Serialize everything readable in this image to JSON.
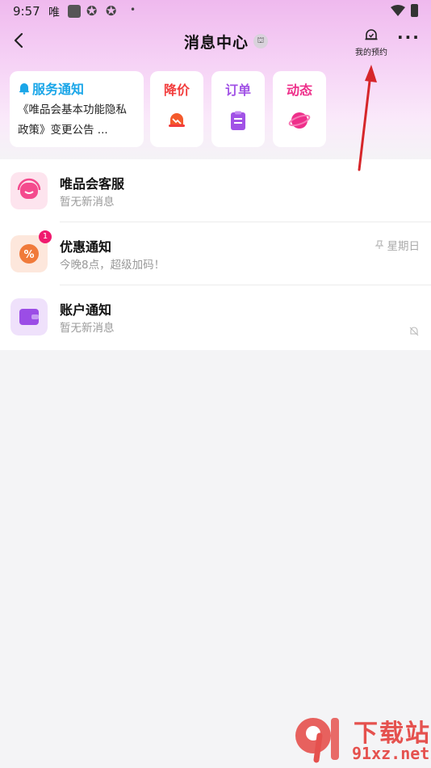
{
  "status_bar": {
    "time": "9:57",
    "app_char": "唯",
    "dot": "•"
  },
  "header": {
    "title": "消息中心",
    "title_badge": "⛫",
    "reservation_label": "我的预约",
    "more_label": "···"
  },
  "cards": {
    "service_notice": {
      "title": "服务通知",
      "body": "《唯品会基本功能隐私政策》变更公告 ..."
    },
    "price_drop": {
      "label": "降价",
      "color": "#f23c3c"
    },
    "orders": {
      "label": "订单",
      "color": "#a152e6"
    },
    "activity": {
      "label": "动态",
      "color": "#ee2f8a"
    }
  },
  "messages": [
    {
      "title": "唯品会客服",
      "subtitle": "暂无新消息",
      "icon": "headset-icon",
      "accent": "#f44a8d"
    },
    {
      "title": "优惠通知",
      "subtitle": "今晚8点，超级加码！",
      "icon": "discount-icon",
      "accent": "#f07a3a",
      "badge": "1",
      "time": "星期日"
    },
    {
      "title": "账户通知",
      "subtitle": "暂无新消息",
      "icon": "wallet-icon",
      "accent": "#9b4de6"
    }
  ],
  "watermark": {
    "logo_text": "下载站",
    "site": "91xz.net",
    "mark": "9"
  }
}
